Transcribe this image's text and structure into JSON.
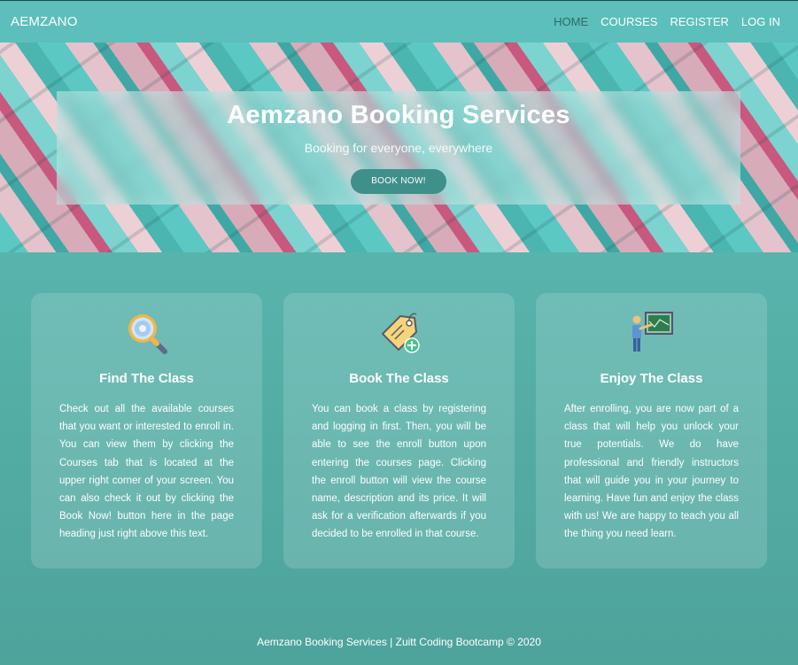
{
  "navbar": {
    "brand": "AEMZANO",
    "links": [
      {
        "label": "HOME",
        "active": true
      },
      {
        "label": "COURSES",
        "active": false
      },
      {
        "label": "REGISTER",
        "active": false
      },
      {
        "label": "LOG IN",
        "active": false
      }
    ]
  },
  "hero": {
    "title": "Aemzano Booking Services",
    "subtitle": "Booking for everyone, everywhere",
    "button_label": "BOOK NOW!"
  },
  "cards": [
    {
      "icon": "magnifier-icon",
      "title": "Find The Class",
      "text": "Check out all the available courses that you want or interested to enroll in. You can view them by clicking the Courses tab that is located at the upper right corner of your screen. You can also check it out by clicking the Book Now! button here in the page heading just right above this text."
    },
    {
      "icon": "price-tag-icon",
      "title": "Book The Class",
      "text": "You can book a class by registering and logging in first. Then, you will be able to see the enroll button upon entering the courses page. Clicking the enroll button will view the course name, description and its price. It will ask for a verification afterwards if you decided to be enrolled in that course."
    },
    {
      "icon": "teacher-board-icon",
      "title": "Enjoy The Class",
      "text": "After enrolling, you are now part of a class that will help you unlock your true potentials. We do have professional and friendly instructors that will guide you in your journey to learning. Have fun and enjoy the class with us! We are happy to teach you all the thing you need learn."
    }
  ],
  "footer": {
    "text": "Aemzano Booking Services | Zuitt Coding Bootcamp © 2020"
  },
  "colors": {
    "navbar_bg": "#5cbfbb",
    "page_bg": "#56b2aa",
    "active_link": "#2f6a66",
    "button_bg": "#3f8f8a"
  }
}
